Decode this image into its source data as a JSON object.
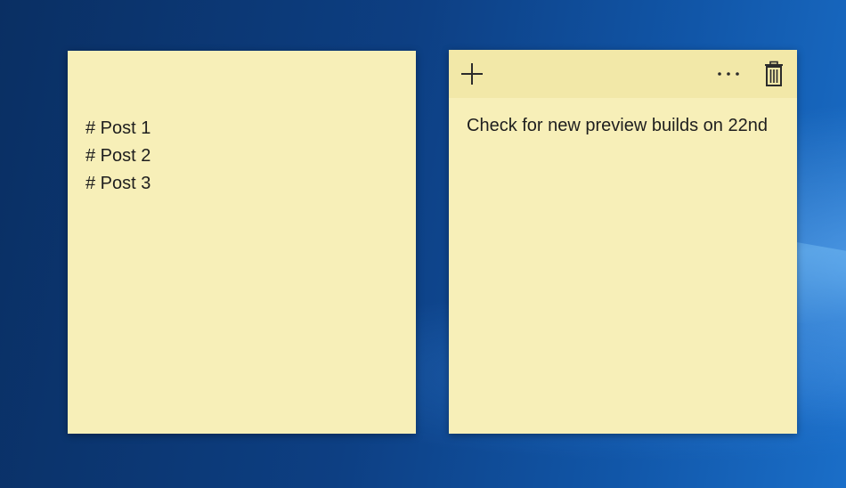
{
  "notes": [
    {
      "lines": [
        "# Post 1",
        "# Post 2",
        "# Post 3"
      ]
    },
    {
      "text": "Check for new preview builds on 22nd",
      "toolbar": {
        "add_icon": "plus-icon",
        "more_icon": "more-dots-icon",
        "delete_icon": "trash-icon"
      }
    }
  ],
  "colors": {
    "note_background": "#f7efb8",
    "note_toolbar": "#f2e8a8",
    "desktop_dark": "#0a2f63",
    "desktop_light": "#1a6ec8"
  }
}
